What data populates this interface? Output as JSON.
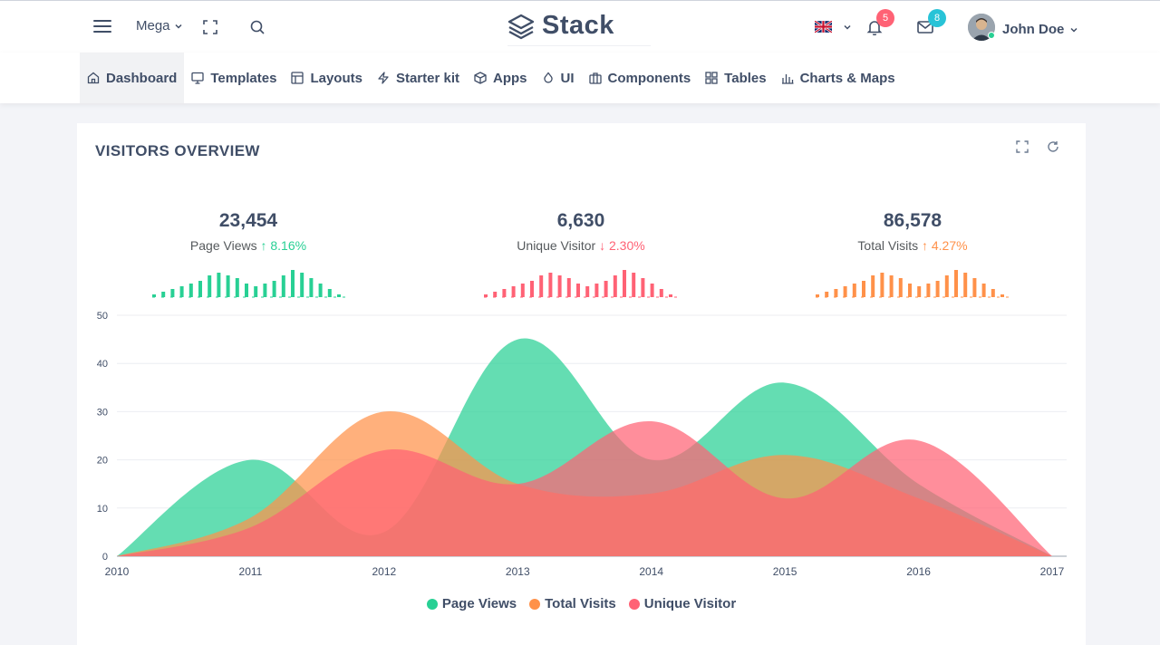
{
  "header": {
    "mega_label": "Mega",
    "brand": "Stack",
    "notifications_count": "5",
    "messages_count": "8",
    "user_name": "John Doe"
  },
  "nav": {
    "items": [
      {
        "label": "Dashboard",
        "icon": "home-icon",
        "active": true
      },
      {
        "label": "Templates",
        "icon": "monitor-icon"
      },
      {
        "label": "Layouts",
        "icon": "layout-icon"
      },
      {
        "label": "Starter kit",
        "icon": "zap-icon"
      },
      {
        "label": "Apps",
        "icon": "package-icon"
      },
      {
        "label": "UI",
        "icon": "droplet-icon"
      },
      {
        "label": "Components",
        "icon": "briefcase-icon"
      },
      {
        "label": "Tables",
        "icon": "grid-icon"
      },
      {
        "label": "Charts & Maps",
        "icon": "bar-chart-icon"
      }
    ]
  },
  "card": {
    "title": "VISITORS OVERVIEW"
  },
  "stats": [
    {
      "value": "23,454",
      "label": "Page Views",
      "arrow": "↑",
      "change": "8.16%",
      "color": "#28d094"
    },
    {
      "value": "6,630",
      "label": "Unique Visitor",
      "arrow": "↓",
      "change": "2.30%",
      "color": "#ff6275"
    },
    {
      "value": "86,578",
      "label": "Total Visits",
      "arrow": "↑",
      "change": "4.27%",
      "color": "#ff9149"
    }
  ],
  "colors": {
    "page_views": "#28d094",
    "total_visits": "#ff9149",
    "unique_visitor": "#ff6275",
    "text": "#404e67"
  },
  "chart_data": {
    "type": "area",
    "x": [
      "2010",
      "2011",
      "2012",
      "2013",
      "2014",
      "2015",
      "2016",
      "2017"
    ],
    "ylim": [
      0,
      50
    ],
    "yticks": [
      0,
      10,
      20,
      30,
      40,
      50
    ],
    "series": [
      {
        "name": "Page Views",
        "values": [
          0,
          20,
          5,
          45,
          20,
          36,
          15,
          0
        ],
        "color": "#28d094"
      },
      {
        "name": "Total Visits",
        "values": [
          0,
          8,
          30,
          15,
          13,
          21,
          12,
          0
        ],
        "color": "#ff9149"
      },
      {
        "name": "Unique Visitor",
        "values": [
          0,
          6,
          22,
          15,
          28,
          12,
          24,
          0
        ],
        "color": "#ff6275"
      }
    ],
    "legend_position": "bottom"
  },
  "sparklines": [
    [
      1,
      2,
      3,
      4,
      5,
      6,
      8,
      9,
      8,
      7,
      5,
      4,
      5,
      6,
      8,
      10,
      9,
      7,
      5,
      3,
      1
    ],
    [
      1,
      2,
      3,
      4,
      5,
      6,
      8,
      9,
      8,
      7,
      5,
      4,
      5,
      6,
      8,
      10,
      9,
      7,
      5,
      3,
      1
    ],
    [
      1,
      2,
      3,
      4,
      5,
      6,
      8,
      9,
      8,
      7,
      5,
      4,
      5,
      6,
      8,
      10,
      9,
      7,
      5,
      3,
      1
    ]
  ]
}
